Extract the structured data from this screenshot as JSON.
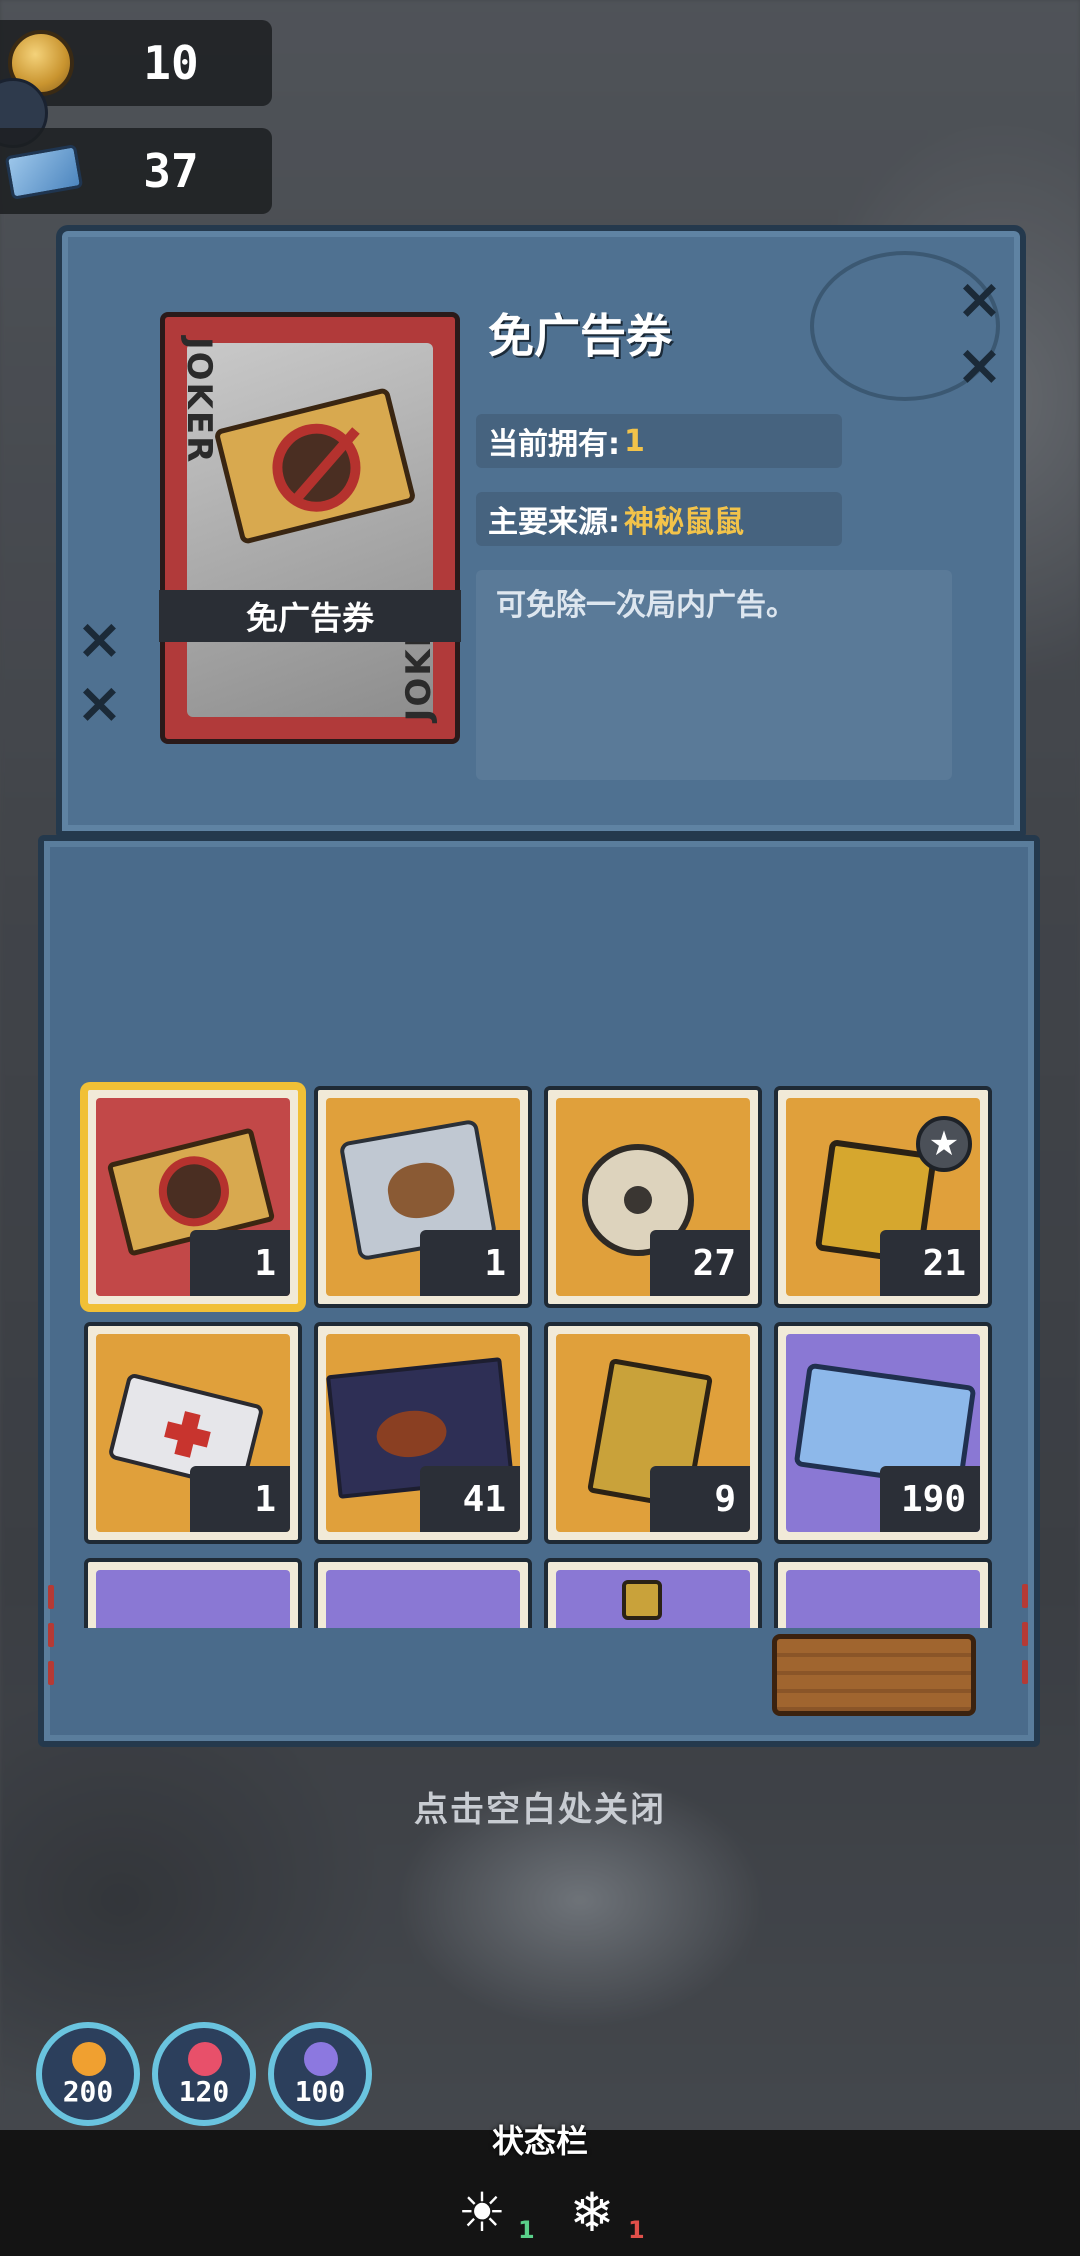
{
  "currencies": [
    {
      "name": "coin",
      "value": "10"
    },
    {
      "name": "ticket",
      "value": "37"
    }
  ],
  "detail": {
    "title": "免广告券",
    "card_label": "免广告券",
    "card_text_left": "JOKER",
    "card_text_right": "JOKER",
    "owned_label": "当前拥有:",
    "owned_value": "1",
    "source_label": "主要来源:",
    "source_value": "神秘鼠鼠",
    "description": "可免除一次局内广告。"
  },
  "items": [
    {
      "color": "red",
      "icon": "no-ad-ticket-icon",
      "count": "1",
      "selected": true
    },
    {
      "color": "orange",
      "icon": "capybara-bag-icon",
      "count": "1"
    },
    {
      "color": "orange",
      "icon": "film-reel-icon",
      "count": "27"
    },
    {
      "color": "orange",
      "icon": "gold-badge-icon",
      "count": "21",
      "badge": "star-icon"
    },
    {
      "color": "orange",
      "icon": "medical-card-icon",
      "count": "1"
    },
    {
      "color": "orange",
      "icon": "steak-poster-icon",
      "count": "41"
    },
    {
      "color": "orange",
      "icon": "golden-ribbon-card-icon",
      "count": "9"
    },
    {
      "color": "purple",
      "icon": "toy-ticket-icon",
      "count": "190"
    },
    {
      "color": "purple",
      "icon": "item-icon",
      "count": ""
    },
    {
      "color": "purple",
      "icon": "item-icon",
      "count": ""
    },
    {
      "color": "purple",
      "icon": "bottle-icon",
      "count": ""
    },
    {
      "color": "purple",
      "icon": "item-icon",
      "count": ""
    }
  ],
  "close_hint": "点击空白处关闭",
  "stats": [
    {
      "name": "hunger",
      "value": "200",
      "color": "#f0a030"
    },
    {
      "name": "health",
      "value": "120",
      "color": "#e8506a"
    },
    {
      "name": "sanity",
      "value": "100",
      "color": "#8c78e0"
    }
  ],
  "status_bar": {
    "title": "状态栏",
    "effects": [
      {
        "icon": "sun-icon",
        "value": "1",
        "color": "#5ad08a"
      },
      {
        "icon": "snowflake-icon",
        "value": "1",
        "color": "#e0504a"
      }
    ]
  }
}
